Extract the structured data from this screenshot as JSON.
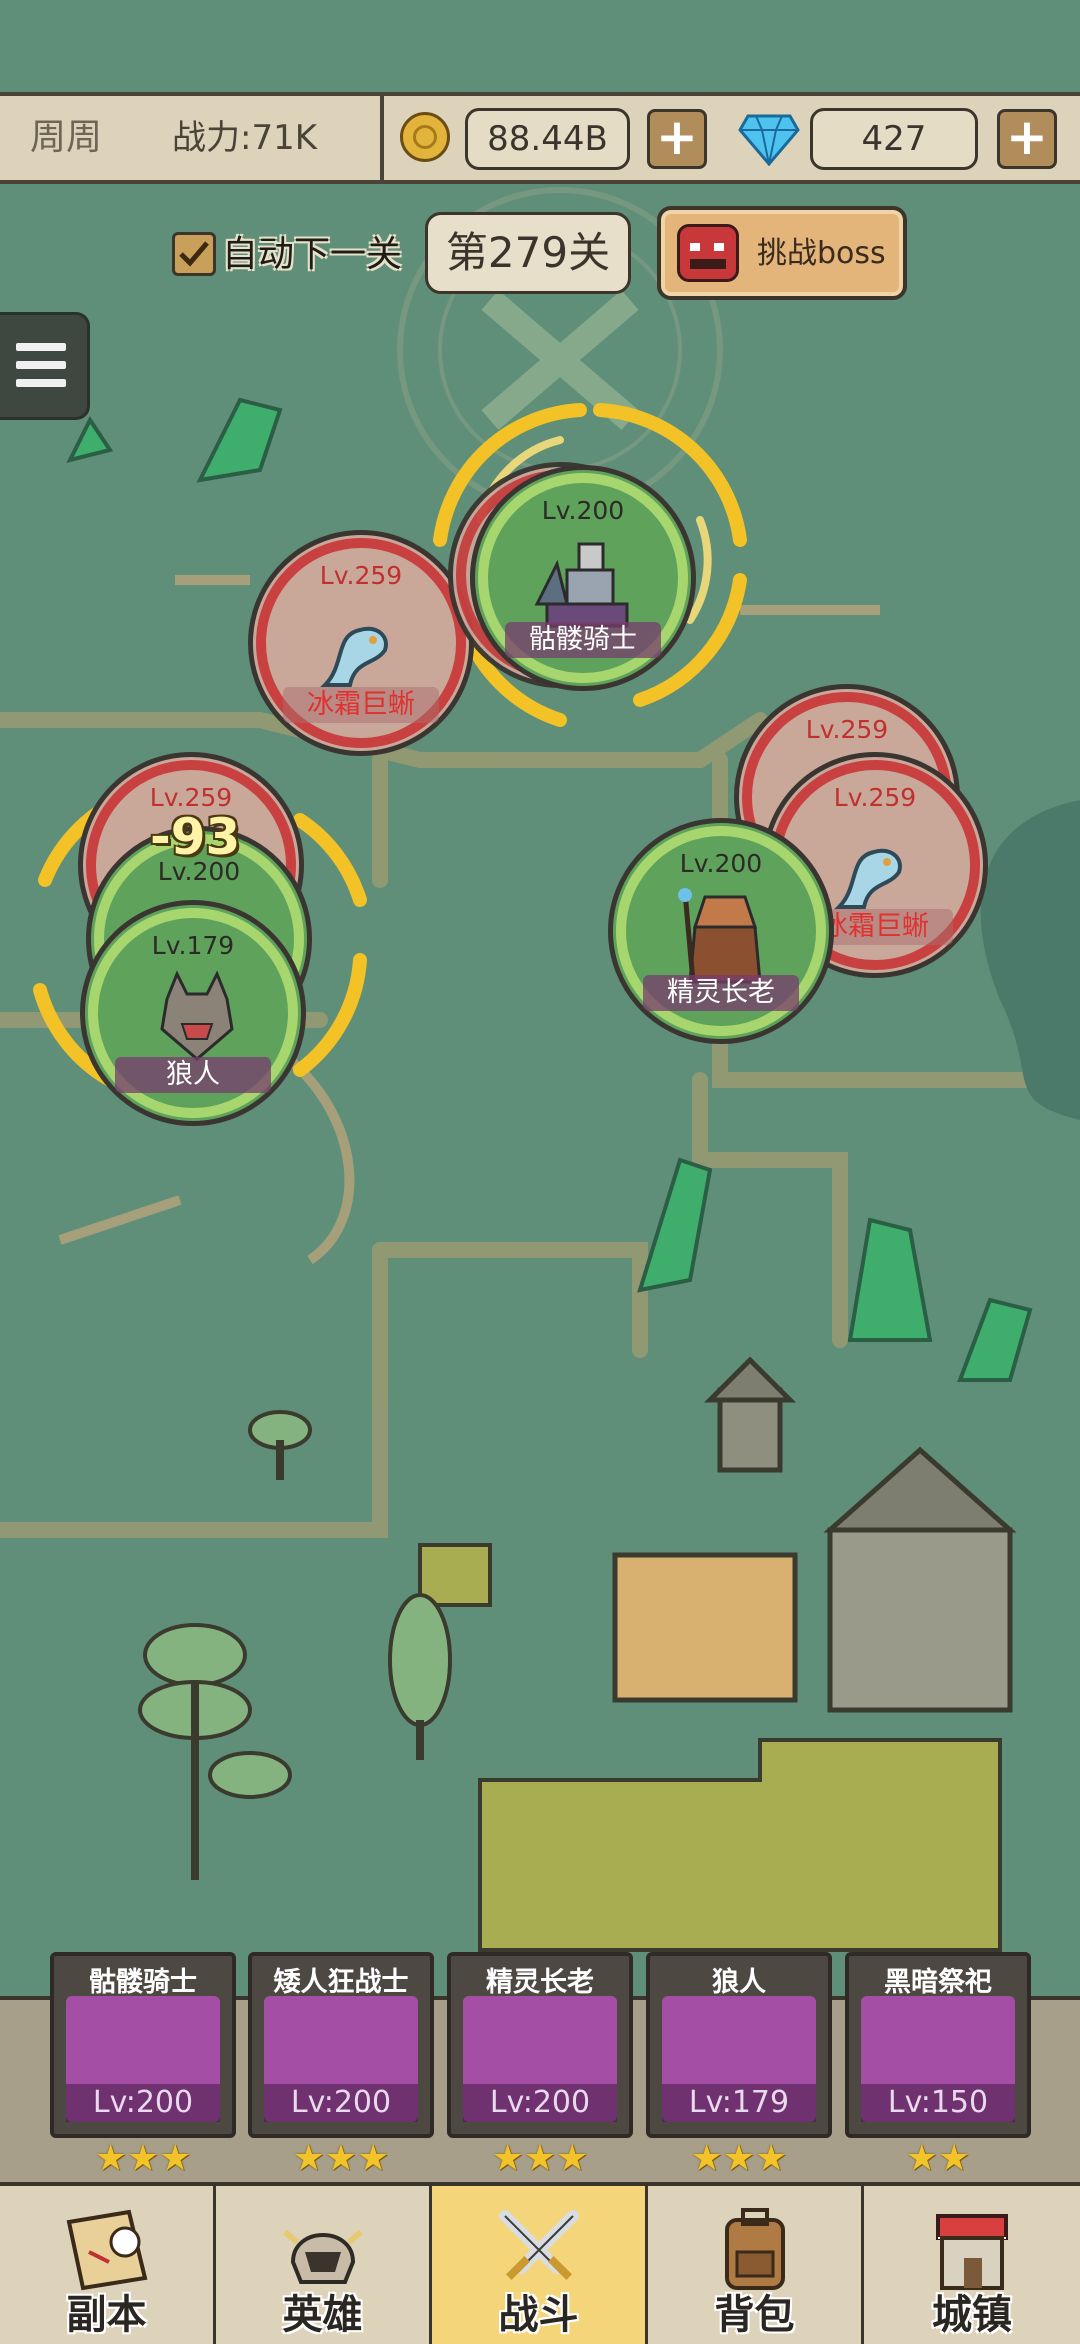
{
  "topbar": {
    "player_name": "周周",
    "power": "战力:71K",
    "gold": "88.44B",
    "gems": "427",
    "add_symbol": "+"
  },
  "stage": {
    "auto_next_label": "自动下一关",
    "auto_next_checked": true,
    "stage_label": "第279关",
    "boss_button_label": "挑战boss"
  },
  "menu_icon": "hamburger-menu-icon",
  "battle_nodes": [
    {
      "side": "enemy",
      "level": "Lv.259",
      "name": "冰霜巨蜥"
    },
    {
      "side": "ally",
      "level": "Lv.200",
      "name": "骷髅骑士"
    },
    {
      "side": "enemy",
      "level": "Lv.259",
      "name": ""
    },
    {
      "side": "enemy",
      "level": "Lv.259",
      "name": "冰霜巨蜥"
    },
    {
      "side": "ally",
      "level": "Lv.200",
      "name": "精灵长老"
    },
    {
      "side": "enemy",
      "level": "Lv.259",
      "name": ""
    },
    {
      "side": "ally",
      "level": "Lv.200",
      "name": ""
    },
    {
      "side": "ally",
      "level": "Lv.179",
      "name": "狼人"
    }
  ],
  "damage_popup": "-93",
  "heroes": [
    {
      "name": "骷髅骑士",
      "level": "Lv:200",
      "stars": "★★★"
    },
    {
      "name": "矮人狂战士",
      "level": "Lv:200",
      "stars": "★★★"
    },
    {
      "name": "精灵长老",
      "level": "Lv:200",
      "stars": "★★★"
    },
    {
      "name": "狼人",
      "level": "Lv:179",
      "stars": "★★★"
    },
    {
      "name": "黑暗祭祀",
      "level": "Lv:150",
      "stars": "★★"
    }
  ],
  "nav": [
    {
      "label": "副本",
      "icon": "map-scroll-icon"
    },
    {
      "label": "英雄",
      "icon": "helmet-icon"
    },
    {
      "label": "战斗",
      "icon": "crossed-swords-icon",
      "active": true
    },
    {
      "label": "背包",
      "icon": "backpack-icon"
    },
    {
      "label": "城镇",
      "icon": "shop-icon"
    }
  ],
  "colors": {
    "map_bg": "#5f8f79",
    "enemy_ring": "#c94040",
    "ally_ring": "#a7d66e",
    "active_tab": "#f5d57a",
    "hero_portrait": "#a44fa5"
  }
}
